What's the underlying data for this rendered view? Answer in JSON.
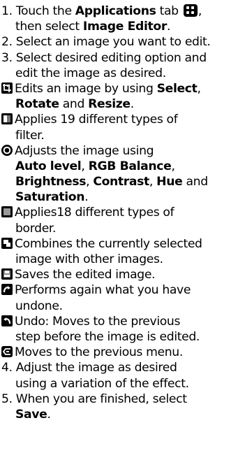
{
  "steps": {
    "s1": {
      "num": "1.",
      "a": "Touch the ",
      "b1": "Applications",
      "c": " tab ",
      "d": ",",
      "cont_b": "Image Editor",
      "cont_pre": "then select ",
      "cont_post": "."
    },
    "s2": {
      "text": "2. Select an image you want to edit."
    },
    "s3": {
      "l1": "3. Select desired editing option and",
      "l2": "edit the image as desired."
    },
    "s4": {
      "l1": "4. Adjust the image as desired",
      "l2": "using a variation of the effect."
    },
    "s5": {
      "l1": "5. When you are finished, select",
      "b": "Save",
      "post": "."
    }
  },
  "options": {
    "edit": {
      "icon": "crop-rotate-icon",
      "t1": "Edits an image by using ",
      "b1": "Select",
      "t2": ",",
      "b2": "Rotate",
      "t3": " and ",
      "b3": "Resize",
      "t4": "."
    },
    "filter": {
      "icon": "filter-icon",
      "l1": "Applies 19 different types of",
      "l2": "filter."
    },
    "adjust": {
      "icon": "adjust-icon",
      "l1": "Adjusts the image using",
      "b1": "Auto level",
      "t1": ", ",
      "b2": "RGB Balance",
      "t2": ",",
      "b3": "Brightness",
      "t3": ", ",
      "b4": "Contrast",
      "t4": ", ",
      "b5": "Hue",
      "t5": " and",
      "b6": "Saturation",
      "t6": "."
    },
    "border": {
      "icon": "border-icon",
      "l1": "Applies18 different types of",
      "l2": "border."
    },
    "combine": {
      "icon": "combine-icon",
      "l1": "Combines the currently selected",
      "l2": "image with other images."
    },
    "save": {
      "icon": "save-icon",
      "l1": "Saves the edited image."
    },
    "redo": {
      "icon": "redo-icon",
      "l1": "Performs again what you have",
      "l2": "undone."
    },
    "undo": {
      "icon": "undo-icon",
      "l1": "Undo: Moves to the previous",
      "l2": "step before the image is edited."
    },
    "back": {
      "icon": "back-icon",
      "l1": "Moves to the previous menu."
    }
  }
}
